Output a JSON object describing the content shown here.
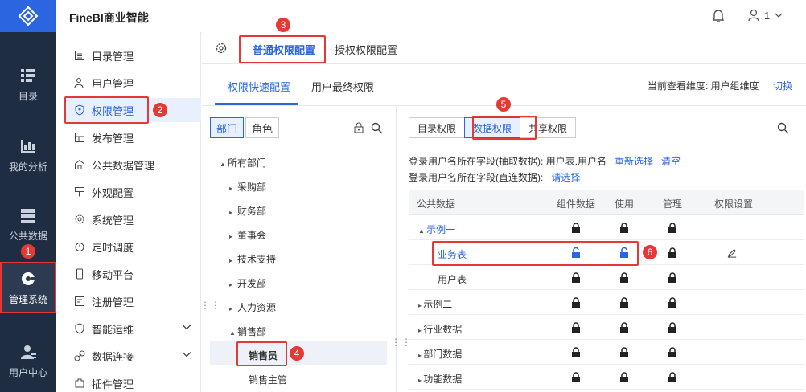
{
  "app": {
    "brand": "FineBI商业智能",
    "user_label": "1"
  },
  "leftnav": [
    {
      "label": "目录",
      "icon": "catalog-icon"
    },
    {
      "label": "我的分析",
      "icon": "analysis-icon"
    },
    {
      "label": "公共数据",
      "icon": "database-icon"
    },
    {
      "label": "管理系统",
      "icon": "admin-gear-icon"
    },
    {
      "label": "用户中心",
      "icon": "user-center-icon"
    }
  ],
  "menu": [
    {
      "label": "目录管理"
    },
    {
      "label": "用户管理"
    },
    {
      "label": "权限管理"
    },
    {
      "label": "发布管理"
    },
    {
      "label": "公共数据管理"
    },
    {
      "label": "外观配置"
    },
    {
      "label": "系统管理"
    },
    {
      "label": "定时调度"
    },
    {
      "label": "移动平台"
    },
    {
      "label": "注册管理"
    },
    {
      "label": "智能运维"
    },
    {
      "label": "数据连接"
    },
    {
      "label": "插件管理"
    }
  ],
  "tabs1": {
    "normal": "普通权限配置",
    "grant": "授权权限配置"
  },
  "tabs2": {
    "quick": "权限快速配置",
    "final": "用户最终权限",
    "view_label": "当前查看维度: 用户组维度",
    "switch": "切换"
  },
  "tree": {
    "seg_dept": "部门",
    "seg_role": "角色",
    "items": [
      "所有部门",
      "采购部",
      "财务部",
      "董事会",
      "技术支持",
      "开发部",
      "人力资源",
      "销售部",
      "销售员",
      "销售主管"
    ]
  },
  "perm": {
    "tabs": [
      "目录权限",
      "数据权限",
      "共享权限"
    ],
    "info1": "登录用户名所在字段(抽取数据): 用户表.用户名",
    "info1_reselect": "重新选择",
    "info1_clear": "清空",
    "info2": "登录用户名所在字段(直连数据):",
    "info2_select": "请选择",
    "headers": [
      "公共数据",
      "组件数据",
      "使用",
      "管理",
      "权限设置"
    ],
    "rows": [
      "示例一",
      "业务表",
      "用户表",
      "示例二",
      "行业数据",
      "部门数据",
      "功能数据"
    ]
  },
  "badges": [
    "1",
    "2",
    "3",
    "4",
    "5",
    "6"
  ],
  "colors": {
    "accent": "#2b66e0",
    "marker": "#e53935",
    "nav_bg": "#1f2d43"
  }
}
